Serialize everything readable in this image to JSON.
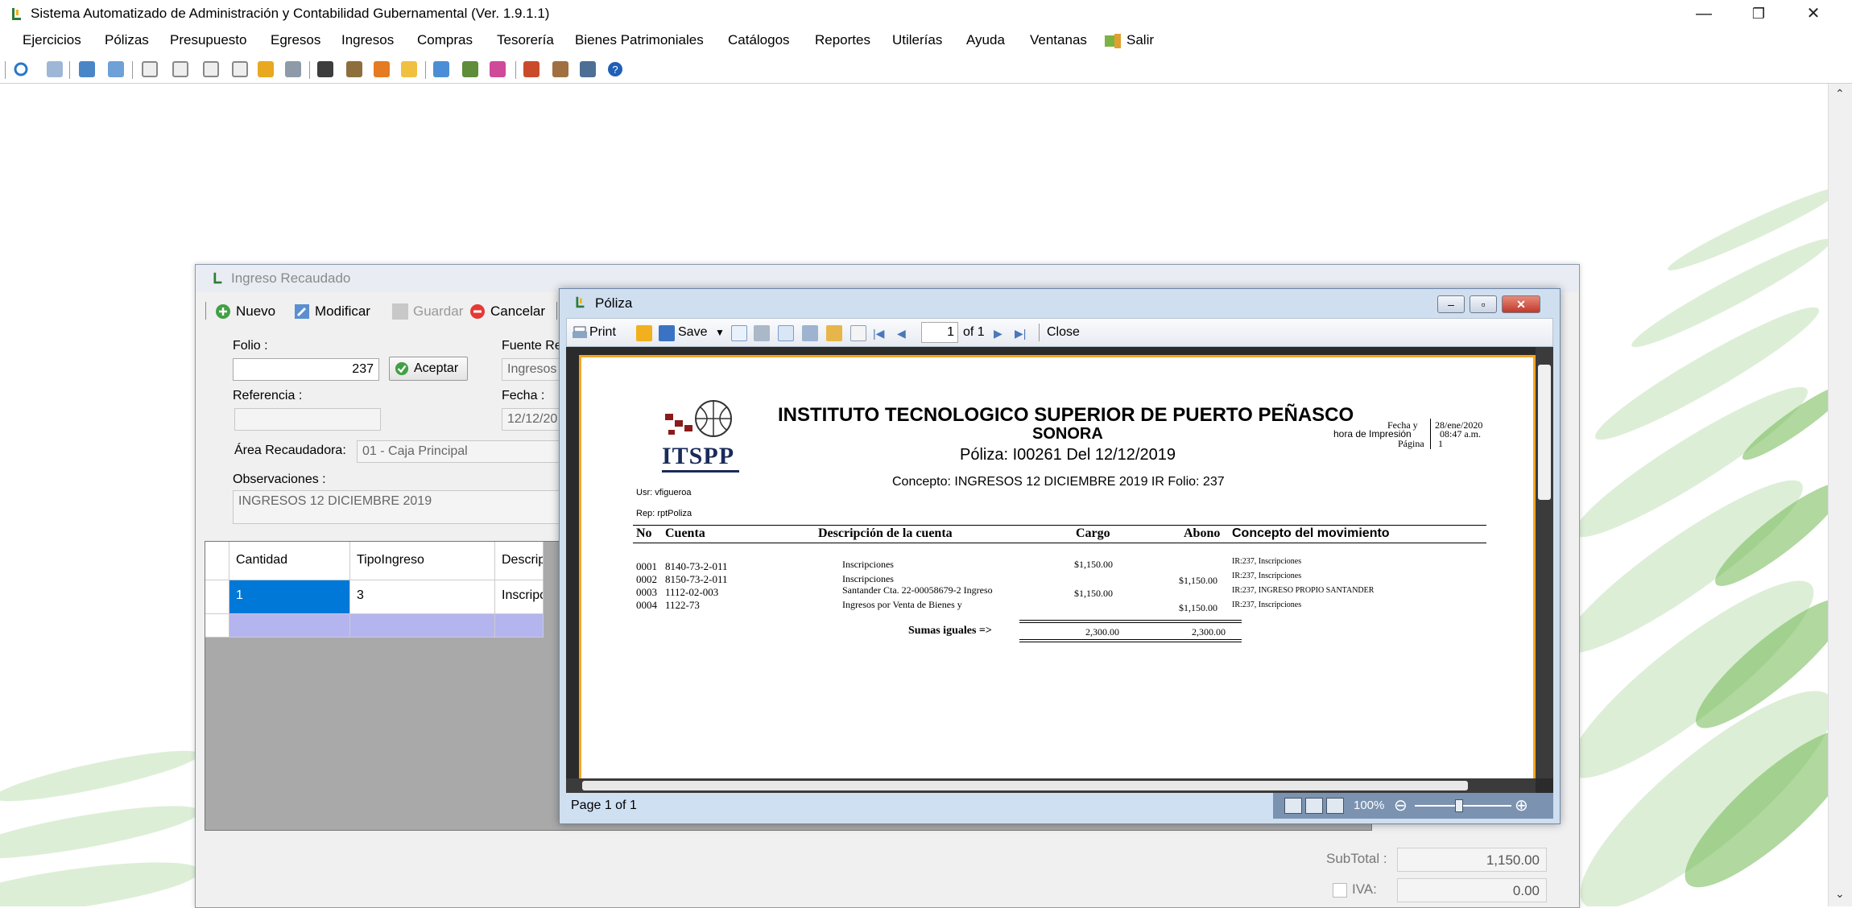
{
  "app": {
    "title": "Sistema Automatizado de Administración y Contabilidad Gubernamental  (Ver. 1.9.1.1)",
    "minimize": "—",
    "restore": "❐",
    "close": "✕"
  },
  "menu": {
    "items": [
      "Ejercicios",
      "Pólizas",
      "Presupuesto",
      "Egresos",
      "Ingresos",
      "Compras",
      "Tesorería",
      "Bienes Patrimoniales",
      "Catálogos",
      "Reportes",
      "Utilerías",
      "Ayuda",
      "Ventanas",
      "Salir"
    ]
  },
  "ingreso": {
    "title": "Ingreso Recaudado",
    "toolbar": {
      "nuevo": "Nuevo",
      "modificar": "Modificar",
      "guardar": "Guardar",
      "cancelar": "Cancelar"
    },
    "folio_label": "Folio :",
    "folio_value": "237",
    "aceptar": "Aceptar",
    "fuente_label": "Fuente Re",
    "fuente_value": "Ingresos",
    "referencia_label": "Referencia :",
    "referencia_value": "",
    "fecha_label": "Fecha :",
    "fecha_value": "12/12/20",
    "area_label": "Área Recaudadora:",
    "area_value": "01 - Caja Principal",
    "obs_label": "Observaciones :",
    "obs_value": "INGRESOS 12  DICIEMBRE 2019",
    "grid": {
      "headers": [
        "Cantidad",
        "TipoIngreso",
        "Descripció"
      ],
      "row": [
        "1",
        "3",
        "Inscripcion"
      ]
    },
    "subtotal_label": "SubTotal :",
    "subtotal_value": "1,150.00",
    "iva_label": "IVA:",
    "iva_value": "0.00"
  },
  "poliza": {
    "title": "Póliza",
    "toolbar": {
      "print": "Print",
      "save": "Save",
      "page_input": "1",
      "of": "of 1",
      "close": "Close"
    },
    "status": "Page 1 of 1",
    "zoom": "100%",
    "report": {
      "logo_text": "ITSPP",
      "institution": "INSTITUTO TECNOLOGICO SUPERIOR DE PUERTO PEÑASCO",
      "state": "SONORA",
      "poliza_line": "Póliza:  I00261  Del 12/12/2019",
      "concepto_line": "Concepto: INGRESOS 12  DICIEMBRE 2019 IR Folio: 237",
      "fecha_label": "Fecha y",
      "fecha_value": "28/ene/2020",
      "hora_label": "hora de Impresión",
      "hora_value": "08:47 a.m.",
      "pagina_label": "Página",
      "pagina_value": "1",
      "usr": "Usr: vfigueroa",
      "rep": "Rep: rptPoliza",
      "headers": [
        "No",
        "Cuenta",
        "Descripción de la cuenta",
        "Cargo",
        "Abono",
        "Concepto del movimiento"
      ],
      "rows": [
        {
          "no": "0001",
          "cuenta": "8140-73-2-011",
          "desc": "Inscripciones",
          "cargo": "$1,150.00",
          "abono": "",
          "concepto": "IR:237, Inscripciones"
        },
        {
          "no": "0002",
          "cuenta": "8150-73-2-011",
          "desc": "Inscripciones",
          "cargo": "",
          "abono": "$1,150.00",
          "concepto": "IR:237, Inscripciones"
        },
        {
          "no": "0003",
          "cuenta": "1112-02-003",
          "desc": "Santander Cta. 22-00058679-2 Ingreso",
          "cargo": "$1,150.00",
          "abono": "",
          "concepto": "IR:237, INGRESO PROPIO SANTANDER"
        },
        {
          "no": "0004",
          "cuenta": "1122-73",
          "desc": "Ingresos por Venta de Bienes y",
          "cargo": "",
          "abono": "$1,150.00",
          "concepto": "IR:237, Inscripciones"
        }
      ],
      "sumas_label": "Sumas iguales =>",
      "sum_cargo": "2,300.00",
      "sum_abono": "2,300.00"
    }
  },
  "colors": {
    "accent_green": "#4caf50",
    "selection_blue": "#0078d7",
    "new_row": "#b4b4ef",
    "report_border": "#f5a623"
  }
}
